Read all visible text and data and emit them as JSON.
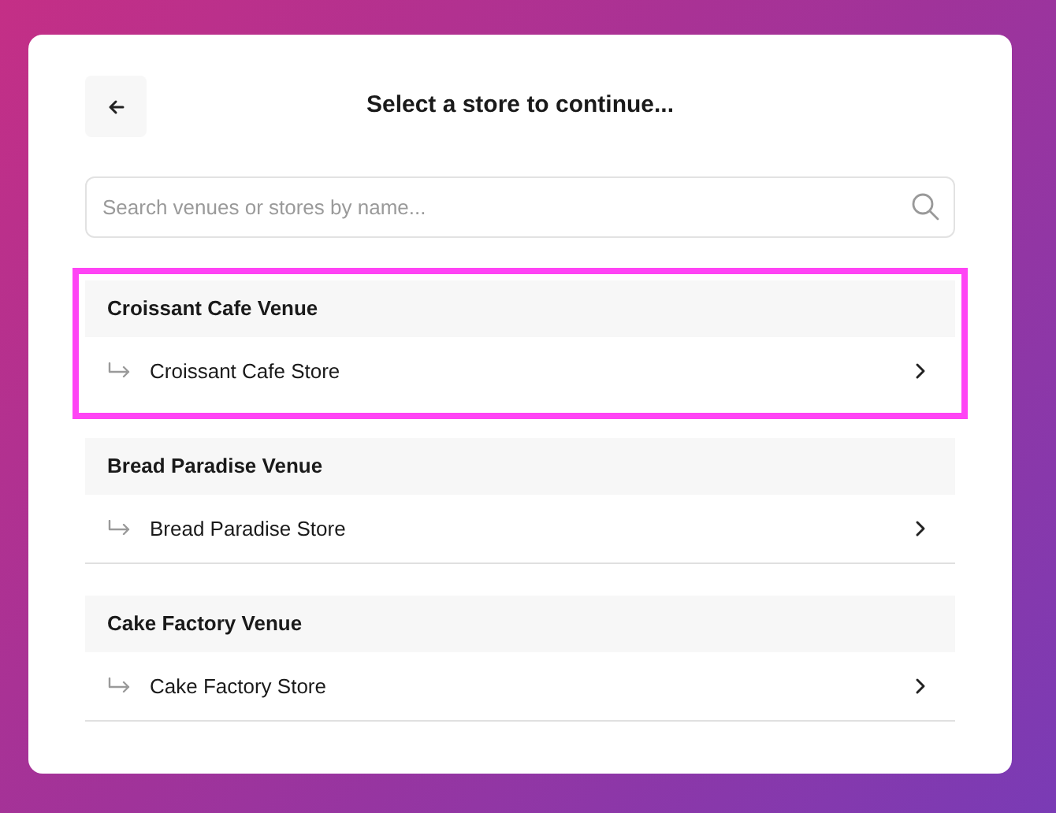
{
  "title": "Select a store to continue...",
  "search": {
    "placeholder": "Search venues or stores by name..."
  },
  "venues": [
    {
      "name": "Croissant Cafe Venue",
      "selected": true,
      "stores": [
        {
          "name": "Croissant Cafe Store"
        }
      ]
    },
    {
      "name": "Bread Paradise Venue",
      "selected": false,
      "stores": [
        {
          "name": "Bread Paradise Store"
        }
      ]
    },
    {
      "name": "Cake Factory Venue",
      "selected": false,
      "stores": [
        {
          "name": "Cake Factory Store"
        }
      ]
    }
  ]
}
